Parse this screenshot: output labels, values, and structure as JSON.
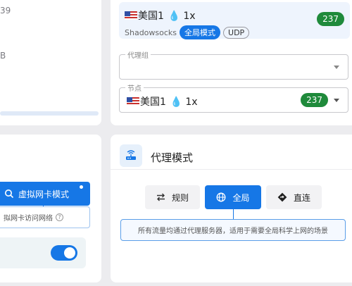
{
  "top_left": {
    "line1": "39",
    "line2": "B"
  },
  "proxy_panel": {
    "selected_node": {
      "name": "美国1",
      "multiplier": "1x",
      "protocol": "Shadowsocks",
      "mode_tag": "全局模式",
      "udp_tag": "UDP",
      "latency": "237"
    },
    "proxy_group": {
      "legend": "代理组",
      "value": ""
    },
    "node_select": {
      "legend": "节点",
      "name": "美国1",
      "multiplier": "1x",
      "latency": "237"
    }
  },
  "tun_panel": {
    "button_label": "虚拟网卡模式",
    "description": "拟网卡访问网络",
    "toggle_on": true
  },
  "mode_panel": {
    "title": "代理模式",
    "buttons": {
      "rule": "规则",
      "global": "全局",
      "direct": "直连"
    },
    "active": "global",
    "description": "所有流量均通过代理服务器，适用于需要全局科学上网的场景"
  },
  "colors": {
    "accent": "#1677e6",
    "latency_badge": "#1f8a3b",
    "background": "#ececef"
  }
}
